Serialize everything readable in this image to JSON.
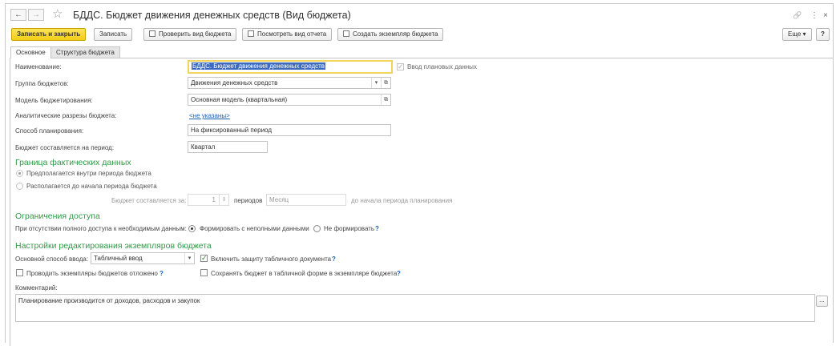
{
  "window": {
    "title": "БДДС. Бюджет движения денежных средств (Вид бюджета)",
    "nav_back": "←",
    "nav_forward": "→",
    "star": "☆",
    "link_icon": "🔗",
    "menu_icon": "⋮",
    "close_icon": "×"
  },
  "toolbar": {
    "save_close": "Записать и закрыть",
    "save": "Записать",
    "check": "Проверить вид бюджета",
    "view_report": "Посмотреть вид отчета",
    "create_instance": "Создать экземпляр бюджета",
    "more": "Еще",
    "more_arrow": "▾",
    "help": "?"
  },
  "tabs": [
    {
      "label": "Основное",
      "active": true
    },
    {
      "label": "Структура бюджета",
      "active": false
    }
  ],
  "form": {
    "name_label": "Наименование:",
    "name_value": "БДДС. Бюджет движения денежных средств",
    "plan_data_label": "Ввод плановых данных",
    "plan_data_checked": true,
    "group_label": "Группа бюджетов:",
    "group_value": "Движения денежных средств",
    "model_label": "Модель бюджетирования:",
    "model_value": "Основная модель (квартальная)",
    "analytics_label": "Аналитические разрезы бюджета:",
    "analytics_value": "<не указаны>",
    "planning_label": "Способ планирования:",
    "planning_value": "На фиксированный период",
    "period_label": "Бюджет составляется на период:",
    "period_value": "Квартал"
  },
  "boundary": {
    "title": "Граница фактических данных",
    "option1": "Предполагается внутри периода бюджета",
    "option2": "Располагается до начала периода бюджета",
    "selected": 1,
    "compose_label": "Бюджет составляется за:",
    "compose_count": "1",
    "periods_label": "периодов",
    "period_unit": "Месяц",
    "before_label": "до начала периода планирования"
  },
  "access": {
    "title": "Ограничения доступа",
    "no_access_label": "При отсутствии полного доступа к необходимым данным:",
    "option1": "Формировать с неполными данными",
    "option2": "Не формировать",
    "selected": 1,
    "help": "?"
  },
  "edit_settings": {
    "title": "Настройки редактирования экземпляров бюджета",
    "input_label": "Основной способ ввода:",
    "input_value": "Табличный ввод",
    "protect_label": "Включить защиту табличного документа",
    "protect_checked": true,
    "postpone_label": "Проводить экземпляры бюджетов отложено",
    "postpone_checked": false,
    "save_table_label": "Сохранять бюджет в табличной форме в экземпляре бюджета",
    "save_table_checked": false,
    "help": "?"
  },
  "comment": {
    "label": "Комментарий:",
    "value": "Планирование производится от доходов, расходов и закупок",
    "more_btn": "..."
  },
  "colors": {
    "primary_button": "#f2cd17",
    "section_heading": "#2f9a47",
    "link": "#1a5fb4",
    "selection": "#3d6bc0"
  }
}
